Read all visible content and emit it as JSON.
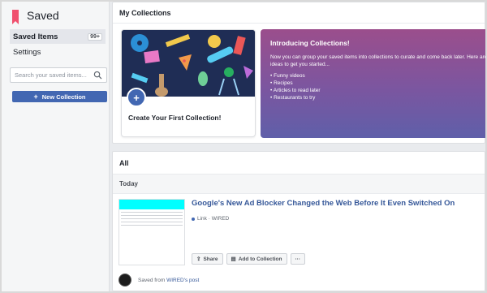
{
  "app": {
    "title": "Saved"
  },
  "sidebar": {
    "items": [
      {
        "label": "Saved Items",
        "badge": "99+"
      },
      {
        "label": "Settings"
      }
    ],
    "search_placeholder": "Search your saved items...",
    "new_collection_label": "New Collection"
  },
  "collections": {
    "title": "My Collections",
    "first_card_label": "Create Your First Collection!",
    "intro": {
      "title": "Introducing Collections!",
      "body": "Now you can group your saved items into collections to curate and come back later. Here are some ideas to get you started...",
      "ideas": [
        "Funny videos",
        "Recipes",
        "Articles to read later",
        "Restaurants to try"
      ]
    }
  },
  "all": {
    "title": "All",
    "section_label": "Today",
    "item": {
      "title": "Google's New Ad Blocker Changed the Web Before It Even Switched On",
      "meta": "Link · WIRED",
      "actions": {
        "share": "Share",
        "add": "Add to Collection",
        "more": "···"
      },
      "saved_from_prefix": "Saved from",
      "saved_from_link": "WIRED's post"
    }
  },
  "colors": {
    "accent": "#4267b2",
    "link": "#365899",
    "brand_icon": "#f0506e"
  }
}
